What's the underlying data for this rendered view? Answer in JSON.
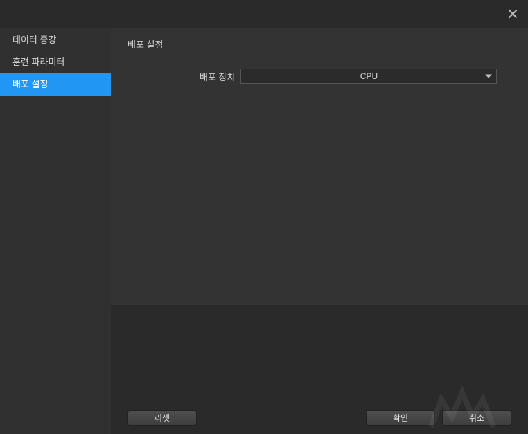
{
  "sidebar": {
    "items": [
      {
        "label": "데이터 증강",
        "active": false
      },
      {
        "label": "훈련 파라미터",
        "active": false
      },
      {
        "label": "배포 설정",
        "active": true
      }
    ]
  },
  "content": {
    "section_title": "배포 설정",
    "device_field": {
      "label": "배포 장치",
      "selected": "CPU"
    }
  },
  "buttons": {
    "reset": "리셋",
    "ok": "확인",
    "cancel": "취소"
  }
}
